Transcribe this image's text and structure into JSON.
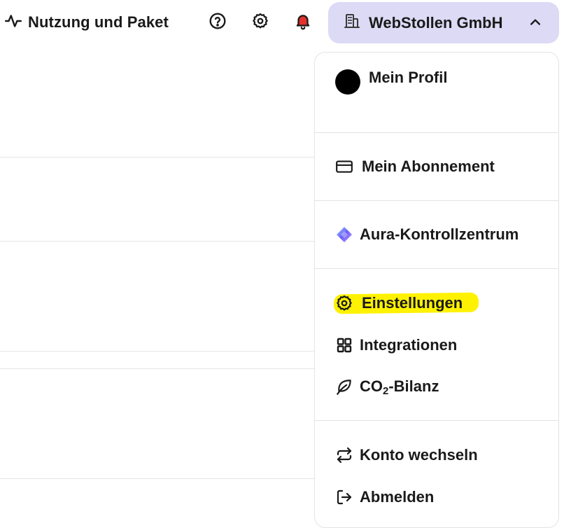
{
  "header": {
    "usage_label": "Nutzung und Paket",
    "account_name": "WebStollen GmbH"
  },
  "icons": {
    "usage": "activity-pulse-icon",
    "help": "help-circle-icon",
    "settings": "gear-icon",
    "bell": "bell-icon",
    "account": "building-icon",
    "chevron": "chevron-up-icon"
  },
  "colors": {
    "account_bg": "#dcdaf5",
    "notification_dot": "#e5322b",
    "highlight": "#fff200",
    "aura_gradient_start": "#6b5cf6",
    "aura_gradient_end": "#9ad7ff"
  },
  "menu": {
    "profile": "Mein Profil",
    "subscription": "Mein Abonnement",
    "aura": "Aura-Kontrollzentrum",
    "settings": "Einstellungen",
    "integrations": "Integrationen",
    "co2_prefix": "CO",
    "co2_sub": "2",
    "co2_suffix": "-Bilanz",
    "switch_account": "Konto wechseln",
    "logout": "Abmelden"
  }
}
